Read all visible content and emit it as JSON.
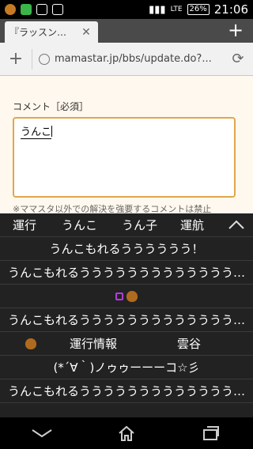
{
  "status": {
    "time": "21:06",
    "battery": "26%",
    "network": "LTE"
  },
  "browser": {
    "tab_title": "『ラッスン…",
    "url": "mamastar.jp/bbs/update.do?..."
  },
  "page": {
    "comment_label": "コメント［必須］",
    "comment_value": "うんこ",
    "notice": "※ママスタ以外での解決を強要するコメントは禁止"
  },
  "ime": {
    "top_candidates": [
      "運行",
      "うんこ",
      "うん子",
      "運航"
    ],
    "rows": [
      "うんこもれるうううううう！",
      "うんこもれるううううううううううううう…",
      "",
      "うんこもれるううううううううううううう…",
      "",
      "(*´∀｀)ノゥゥーーーコ☆彡",
      "うんこもれるううううううううううううう…"
    ],
    "row5_items": [
      "運行情報",
      "雲谷"
    ]
  },
  "icons": {
    "back": "back-chevron-icon",
    "home": "home-icon",
    "recents": "recents-icon"
  },
  "colors": {
    "textarea_border": "#e2a64b",
    "page_bg": "#fff8ee",
    "ime_bg": "#222222"
  }
}
